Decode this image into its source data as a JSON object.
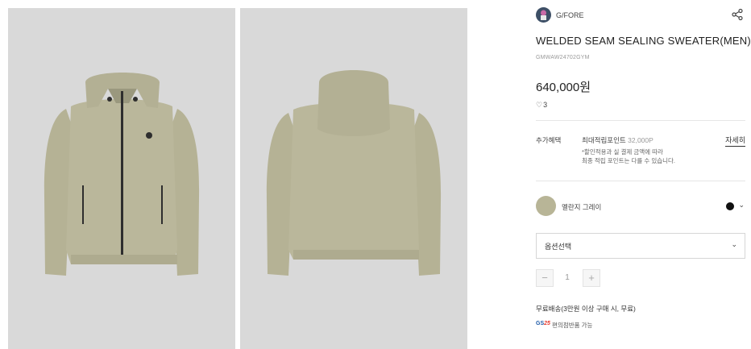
{
  "product": {
    "brand": "G/FORE",
    "title": "WELDED SEAM SEALING SWEATER(MEN)",
    "sku": "GMWAW24702GYM",
    "price": "640,000원",
    "likes": "3"
  },
  "benefits": {
    "label": "추가혜택",
    "max_points_label": "최대적립포인트",
    "max_points_value": "32,000P",
    "note_line1": "*할인적용과 실 결제 금액에 따라",
    "note_line2": "최종 적립 포인트는 다를 수 있습니다.",
    "detail_link": "자세히"
  },
  "color": {
    "name": "멜란지 그레이",
    "swatch_hex": "#b8b597",
    "selected_dot_hex": "#111111"
  },
  "option_select": {
    "label": "옵션선택"
  },
  "quantity": {
    "minus": "−",
    "value": "1",
    "plus": "+"
  },
  "shipping": {
    "text": "무료배송(3만원 이상 구매 시, 무료)",
    "gs_logo_letters": "GS",
    "gs_logo_number": "25",
    "gs_text": "편의점반품 가능"
  },
  "images": [
    {
      "view": "front",
      "color": "#b9b69a"
    },
    {
      "view": "back",
      "color": "#b9b69a"
    }
  ]
}
